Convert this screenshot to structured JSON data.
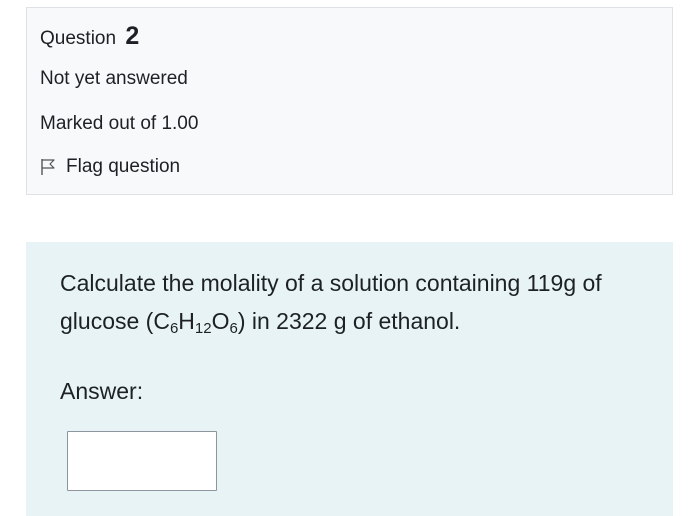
{
  "question": {
    "label": "Question",
    "number": "2",
    "state": "Not yet answered",
    "grade": "Marked out of 1.00",
    "flag_label": "Flag question",
    "flag_icon": "flag-outline-icon"
  },
  "content": {
    "text_prefix": "Calculate the molality of a solution containing 119g of glucose (C",
    "sub_c": "6",
    "text_h": "H",
    "sub_h": "12",
    "text_o": "O",
    "sub_o": "6",
    "text_suffix": ") in 2322 g of ethanol.",
    "answer_label": "Answer:",
    "answer_value": ""
  },
  "colors": {
    "info_background": "#f8f9fa",
    "info_border": "#dee2e6",
    "content_background": "#e7f3f5",
    "text": "#1d2125"
  }
}
